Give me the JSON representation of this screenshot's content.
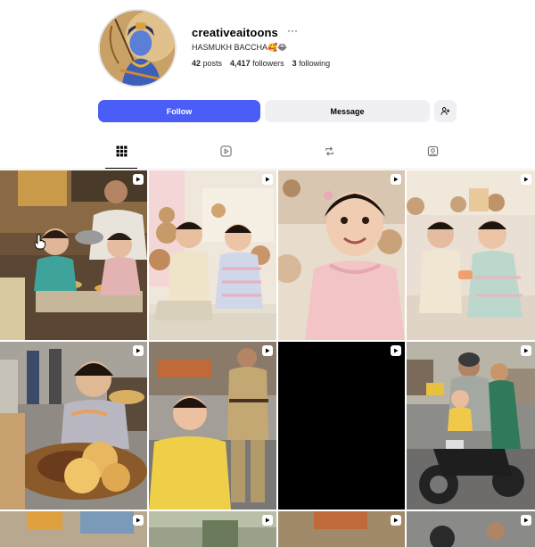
{
  "profile": {
    "username": "creativeaitoons",
    "options_glyph": "···",
    "full_name": "HASMUKH BACCHA🥰😂",
    "stats": {
      "posts_count": "42",
      "posts_label": "posts",
      "followers_count": "4,417",
      "followers_label": "followers",
      "following_count": "3",
      "following_label": "following"
    }
  },
  "actions": {
    "follow_label": "Follow",
    "message_label": "Message",
    "suggest_icon": "add-person-icon"
  },
  "tabs": [
    {
      "icon": "grid-icon",
      "active": true
    },
    {
      "icon": "reels-icon",
      "active": false
    },
    {
      "icon": "reposts-icon",
      "active": false
    },
    {
      "icon": "tagged-icon",
      "active": false
    }
  ],
  "colors": {
    "accent": "#4a5ef7",
    "button_secondary": "#efeff4",
    "text": "#000000"
  },
  "posts": [
    {
      "scene": "toddlers eating at street food stall",
      "type": "reel"
    },
    {
      "scene": "toddlers sitting with teddy bears",
      "type": "reel"
    },
    {
      "scene": "smiling baby girl in pink dress",
      "type": "reel"
    },
    {
      "scene": "toddlers sharing on bed with toys",
      "type": "reel"
    },
    {
      "scene": "toddler eating chole bhature",
      "type": "reel"
    },
    {
      "scene": "toddler with police officer on street",
      "type": "reel"
    },
    {
      "scene": "black post",
      "type": "reel"
    },
    {
      "scene": "family riding motorcycle",
      "type": "reel"
    },
    {
      "scene": "street scene",
      "type": "reel"
    },
    {
      "scene": "street scene",
      "type": "reel"
    },
    {
      "scene": "street scene",
      "type": "reel"
    },
    {
      "scene": "street scene",
      "type": "reel"
    }
  ]
}
